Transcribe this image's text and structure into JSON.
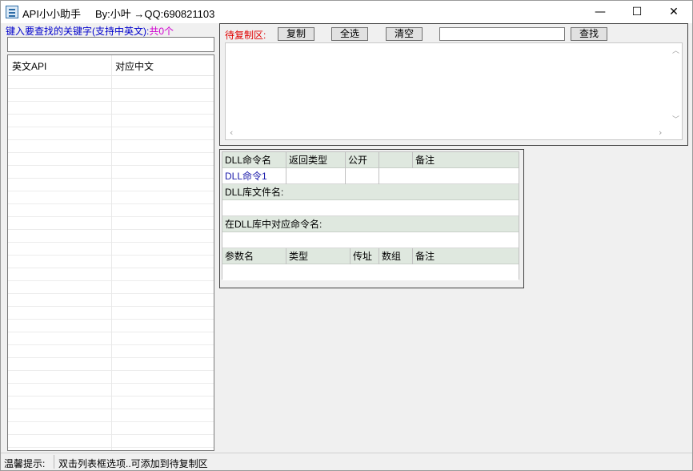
{
  "window": {
    "title": "API小小助手     By:小叶 →QQ:690821103",
    "minimize": "—",
    "maximize": "☐",
    "close": "✕"
  },
  "search": {
    "label": "键入要查找的关键字(支持中英文):",
    "count": "共0个",
    "value": ""
  },
  "api_list": {
    "columns": [
      "英文API",
      "对应中文"
    ],
    "rows": []
  },
  "copy_area": {
    "label": "待复制区:",
    "copy_button": "复制",
    "select_all_button": "全选",
    "clear_button": "清空",
    "find_value": "",
    "find_button": "查找",
    "content": ""
  },
  "dll_table": {
    "header1": [
      "DLL命令名",
      "返回类型",
      "公开",
      "",
      "备注"
    ],
    "row1": [
      "DLL命令1",
      "",
      "",
      ""
    ],
    "lib_label": "DLL库文件名:",
    "lib_value": "",
    "cmd_label": "在DLL库中对应命令名:",
    "cmd_value": "",
    "param_header": [
      "参数名",
      "类型",
      "传址",
      "数组",
      "备注"
    ]
  },
  "status_bar": {
    "label": "温馨提示:",
    "text": "双击列表框选项..可添加到待复制区"
  }
}
